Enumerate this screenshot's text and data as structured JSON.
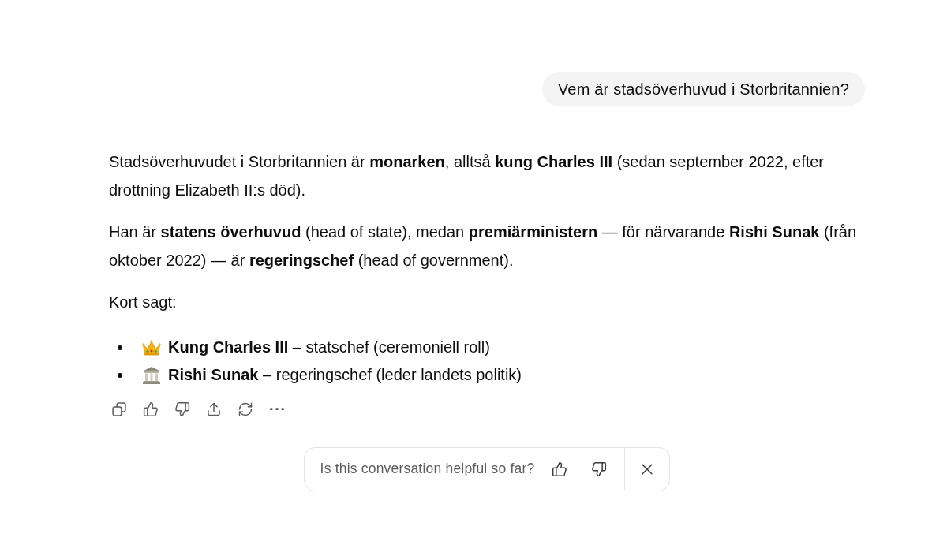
{
  "user_message": {
    "text": "Vem är stadsöverhuvud i Storbritannien?"
  },
  "assistant_message": {
    "paragraphs": [
      "Stadsöverhuvudet i Storbritannien är **monarken**, alltså **kung Charles III** (sedan september 2022, efter drottning Elizabeth II:s död).",
      "Han är **statens överhuvud** (head of state), medan **premiärministern** — för närvarande **Rishi Sunak** (från oktober 2022) — är **regeringschef** (head of government).",
      "Kort sagt:"
    ],
    "bullets": [
      {
        "kind": "crown",
        "text": "**Kung Charles III** – statschef (ceremoniell roll)"
      },
      {
        "kind": "building",
        "text": "**Rishi Sunak** – regeringschef (leder landets politik)"
      }
    ]
  },
  "feedback_prompt": {
    "question": "Is this conversation helpful so far?"
  }
}
